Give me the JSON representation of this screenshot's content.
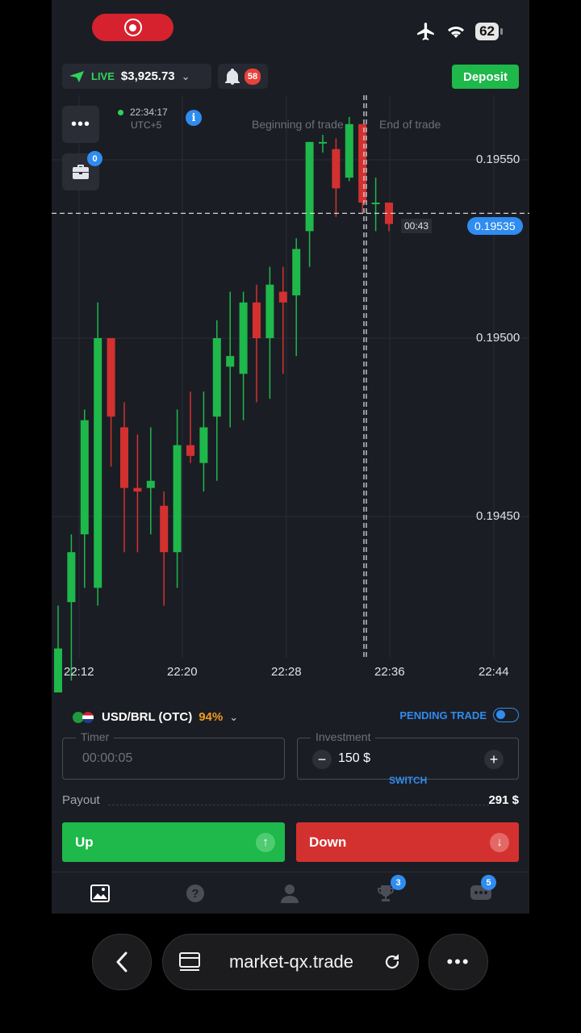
{
  "status_bar": {
    "battery": "62",
    "icons": [
      "record-icon",
      "airplane-icon",
      "wifi-icon",
      "battery-icon"
    ]
  },
  "account": {
    "mode": "LIVE",
    "balance": "$3,925.73",
    "notifications": "58",
    "deposit_label": "Deposit"
  },
  "chart": {
    "clock_time": "22:34:17",
    "clock_tz": "UTC+5",
    "portfolio_count": "0",
    "beginning_label": "Beginning of trade",
    "end_label": "End of trade",
    "current_price": "0.19535",
    "countdown": "00:43",
    "price_ticks": [
      "0.19550",
      "0.19500",
      "0.19450"
    ],
    "time_ticks": [
      "22:12",
      "22:20",
      "22:28",
      "22:36",
      "22:44"
    ]
  },
  "chart_data": {
    "type": "candlestick",
    "asset": "USD/BRL (OTC)",
    "ylim": [
      0.19415,
      0.196
    ],
    "x_ticks": [
      "22:12",
      "22:20",
      "22:28",
      "22:36",
      "22:44"
    ],
    "y_ticks": [
      0.1955,
      0.195,
      0.1945
    ],
    "current_price": 0.19535,
    "candles": [
      {
        "o": 0.19391,
        "c": 0.19413,
        "h": 0.19425,
        "l": 0.1938
      },
      {
        "o": 0.19426,
        "c": 0.1944,
        "h": 0.19445,
        "l": 0.19404
      },
      {
        "o": 0.19445,
        "c": 0.19477,
        "h": 0.1948,
        "l": 0.1943
      },
      {
        "o": 0.1943,
        "c": 0.195,
        "h": 0.1951,
        "l": 0.19425
      },
      {
        "o": 0.195,
        "c": 0.19478,
        "h": 0.195,
        "l": 0.19464
      },
      {
        "o": 0.19475,
        "c": 0.19458,
        "h": 0.19482,
        "l": 0.1944
      },
      {
        "o": 0.19458,
        "c": 0.19457,
        "h": 0.19473,
        "l": 0.1944
      },
      {
        "o": 0.19458,
        "c": 0.1946,
        "h": 0.19475,
        "l": 0.19445
      },
      {
        "o": 0.19453,
        "c": 0.1944,
        "h": 0.19457,
        "l": 0.19425
      },
      {
        "o": 0.1944,
        "c": 0.1947,
        "h": 0.1948,
        "l": 0.1943
      },
      {
        "o": 0.1947,
        "c": 0.19467,
        "h": 0.19485,
        "l": 0.19465
      },
      {
        "o": 0.19465,
        "c": 0.19475,
        "h": 0.19485,
        "l": 0.19457
      },
      {
        "o": 0.19478,
        "c": 0.195,
        "h": 0.19505,
        "l": 0.1946
      },
      {
        "o": 0.19492,
        "c": 0.19495,
        "h": 0.19513,
        "l": 0.19475
      },
      {
        "o": 0.1949,
        "c": 0.1951,
        "h": 0.19513,
        "l": 0.19477
      },
      {
        "o": 0.1951,
        "c": 0.195,
        "h": 0.19515,
        "l": 0.19482
      },
      {
        "o": 0.195,
        "c": 0.19515,
        "h": 0.1952,
        "l": 0.19483
      },
      {
        "o": 0.19513,
        "c": 0.1951,
        "h": 0.1952,
        "l": 0.1949
      },
      {
        "o": 0.19512,
        "c": 0.19525,
        "h": 0.19528,
        "l": 0.19495
      },
      {
        "o": 0.1953,
        "c": 0.19555,
        "h": 0.19555,
        "l": 0.1952
      },
      {
        "o": 0.19555,
        "c": 0.19555,
        "h": 0.19557,
        "l": 0.19552
      },
      {
        "o": 0.19553,
        "c": 0.19542,
        "h": 0.19556,
        "l": 0.19534
      },
      {
        "o": 0.19545,
        "c": 0.1956,
        "h": 0.19562,
        "l": 0.19544
      },
      {
        "o": 0.1956,
        "c": 0.19538,
        "h": 0.1956,
        "l": 0.19535
      },
      {
        "o": 0.19538,
        "c": 0.19538,
        "h": 0.19545,
        "l": 0.1953
      },
      {
        "o": 0.19538,
        "c": 0.19532,
        "h": 0.19538,
        "l": 0.1953
      }
    ]
  },
  "trade": {
    "asset": "USD/BRL (OTC)",
    "payout_pct": "94%",
    "pending_label": "PENDING TRADE",
    "timer_label": "Timer",
    "timer_value": "00:00:05",
    "investment_label": "Investment",
    "investment_value": "150 $",
    "switch_label": "SWITCH",
    "payout_label": "Payout",
    "payout_value": "291 $",
    "up_label": "Up",
    "down_label": "Down"
  },
  "nav": {
    "trophy_badge": "3",
    "chat_badge": "5"
  },
  "browser": {
    "url": "market-qx.trade"
  },
  "colors": {
    "green": "#1eb84b",
    "red": "#d3312f",
    "blue": "#2f8cf0",
    "bg": "#1b1d24"
  }
}
